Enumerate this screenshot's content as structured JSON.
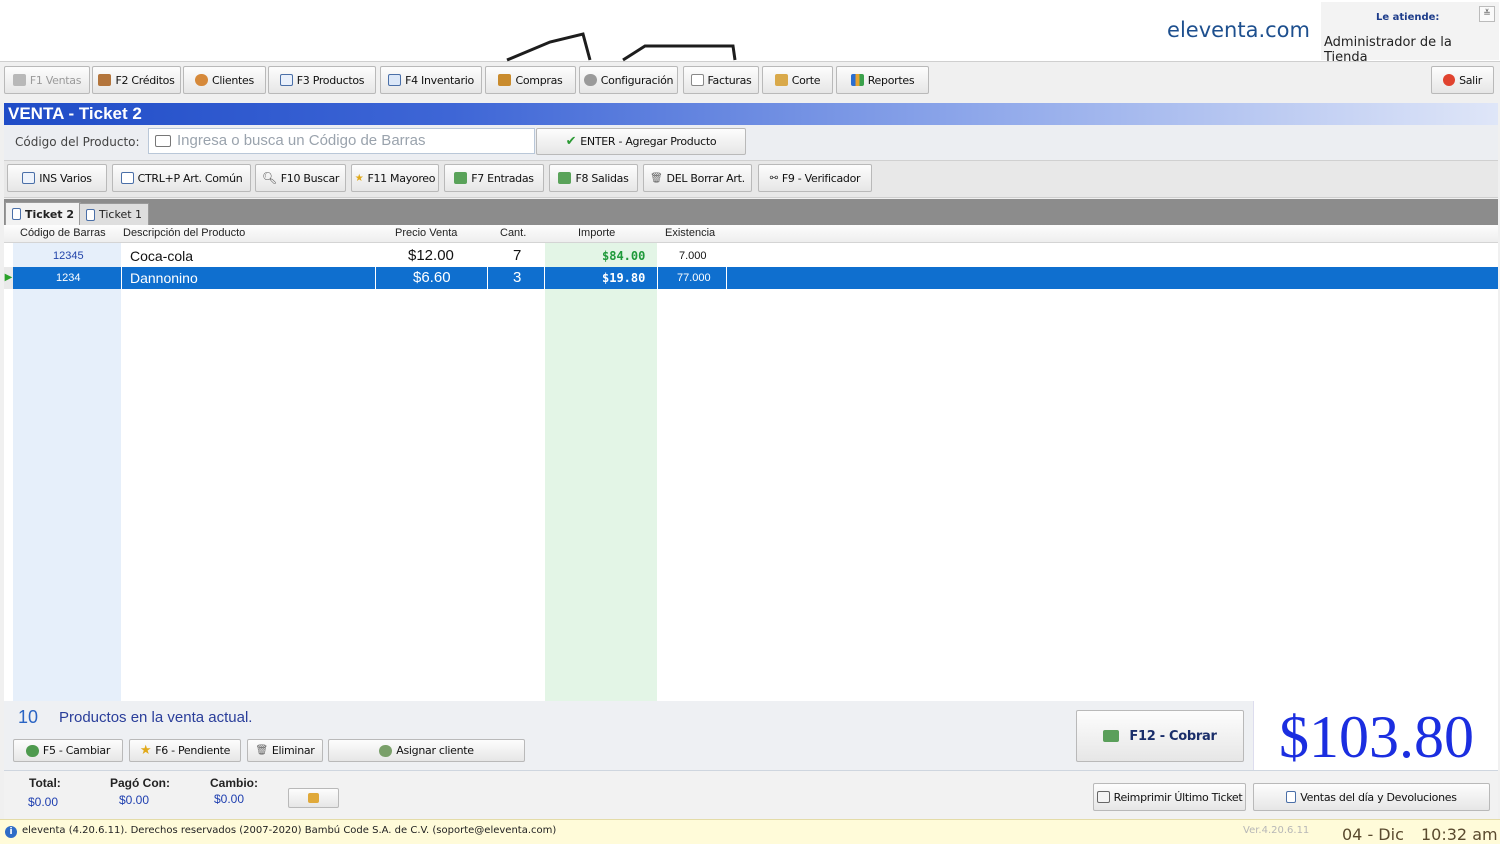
{
  "header": {
    "brand": "eleventa.com",
    "attend_label": "Le atiende:",
    "attend_name": "Administrador de la Tienda"
  },
  "main_toolbar": [
    {
      "label": "F1 Ventas",
      "icon": "cart-icon",
      "disabled": true
    },
    {
      "label": "F2 Créditos",
      "icon": "credit-icon"
    },
    {
      "label": "Clientes",
      "icon": "clients-icon"
    },
    {
      "label": "F3 Productos",
      "icon": "products-icon"
    },
    {
      "label": "F4 Inventario",
      "icon": "inventory-icon"
    },
    {
      "label": "Compras",
      "icon": "truck-icon"
    },
    {
      "label": "Configuración",
      "icon": "gear-icon"
    },
    {
      "label": "Facturas",
      "icon": "invoice-icon"
    },
    {
      "label": "Corte",
      "icon": "cash-cut-icon"
    },
    {
      "label": "Reportes",
      "icon": "chart-icon"
    }
  ],
  "exit_label": "Salir",
  "sale": {
    "title": "VENTA - Ticket 2",
    "code_label": "Código del Producto:",
    "code_placeholder": "Ingresa o busca un Código de Barras",
    "add_button": "ENTER - Agregar Producto"
  },
  "actions": [
    {
      "label": "INS Varios",
      "icon": "various-icon"
    },
    {
      "label": "CTRL+P Art. Común",
      "icon": "document-icon"
    },
    {
      "label": "F10 Buscar",
      "icon": "search-icon"
    },
    {
      "label": "F11 Mayoreo",
      "icon": "star-icon"
    },
    {
      "label": "F7 Entradas",
      "icon": "money-in-icon"
    },
    {
      "label": "F8 Salidas",
      "icon": "money-out-icon"
    },
    {
      "label": "DEL Borrar Art.",
      "icon": "trash-icon"
    },
    {
      "label": "F9 - Verificador",
      "icon": "binoculars-icon"
    }
  ],
  "tabs": [
    "Ticket 2",
    "Ticket 1"
  ],
  "table": {
    "headers": [
      "Código de Barras",
      "Descripción del Producto",
      "Precio Venta",
      "Cant.",
      "Importe",
      "Existencia"
    ],
    "rows": [
      {
        "code": "12345",
        "desc": "Coca-cola",
        "price": "$12.00",
        "qty": "7",
        "amount": "$84.00",
        "stock": "7.000",
        "selected": false
      },
      {
        "code": "1234",
        "desc": "Dannonino",
        "price": "$6.60",
        "qty": "3",
        "amount": "$19.80",
        "stock": "77.000",
        "selected": true
      }
    ]
  },
  "summary": {
    "count": "10",
    "count_label": "Productos en la venta actual.",
    "total_big": "$103.80",
    "charge_button": "F12 - Cobrar"
  },
  "bottom_buttons": [
    {
      "label": "F5 - Cambiar",
      "icon": "change-icon"
    },
    {
      "label": "F6 - Pendiente",
      "icon": "star-icon"
    },
    {
      "label": "Eliminar",
      "icon": "trash-icon"
    },
    {
      "label": "Asignar cliente",
      "icon": "assign-client-icon"
    }
  ],
  "footer": {
    "total_label": "Total:",
    "total_value": "$0.00",
    "paid_label": "Pagó Con:",
    "paid_value": "$0.00",
    "change_label": "Cambio:",
    "change_value": "$0.00",
    "reprint": "Reimprimir Último Ticket",
    "day_sales": "Ventas del día y Devoluciones"
  },
  "status": {
    "text": "eleventa (4.20.6.11). Derechos reservados (2007-2020) Bambú Code S.A. de C.V. (soporte@eleventa.com)",
    "version": "Ver.4.20.6.11",
    "date": "04 - Dic",
    "time": "10:32 am"
  },
  "colors": {
    "accent": "#1f4cc7",
    "selection": "#0f6fcf",
    "total": "#1b2ee0",
    "importe_bg": "#e3f5e6"
  }
}
